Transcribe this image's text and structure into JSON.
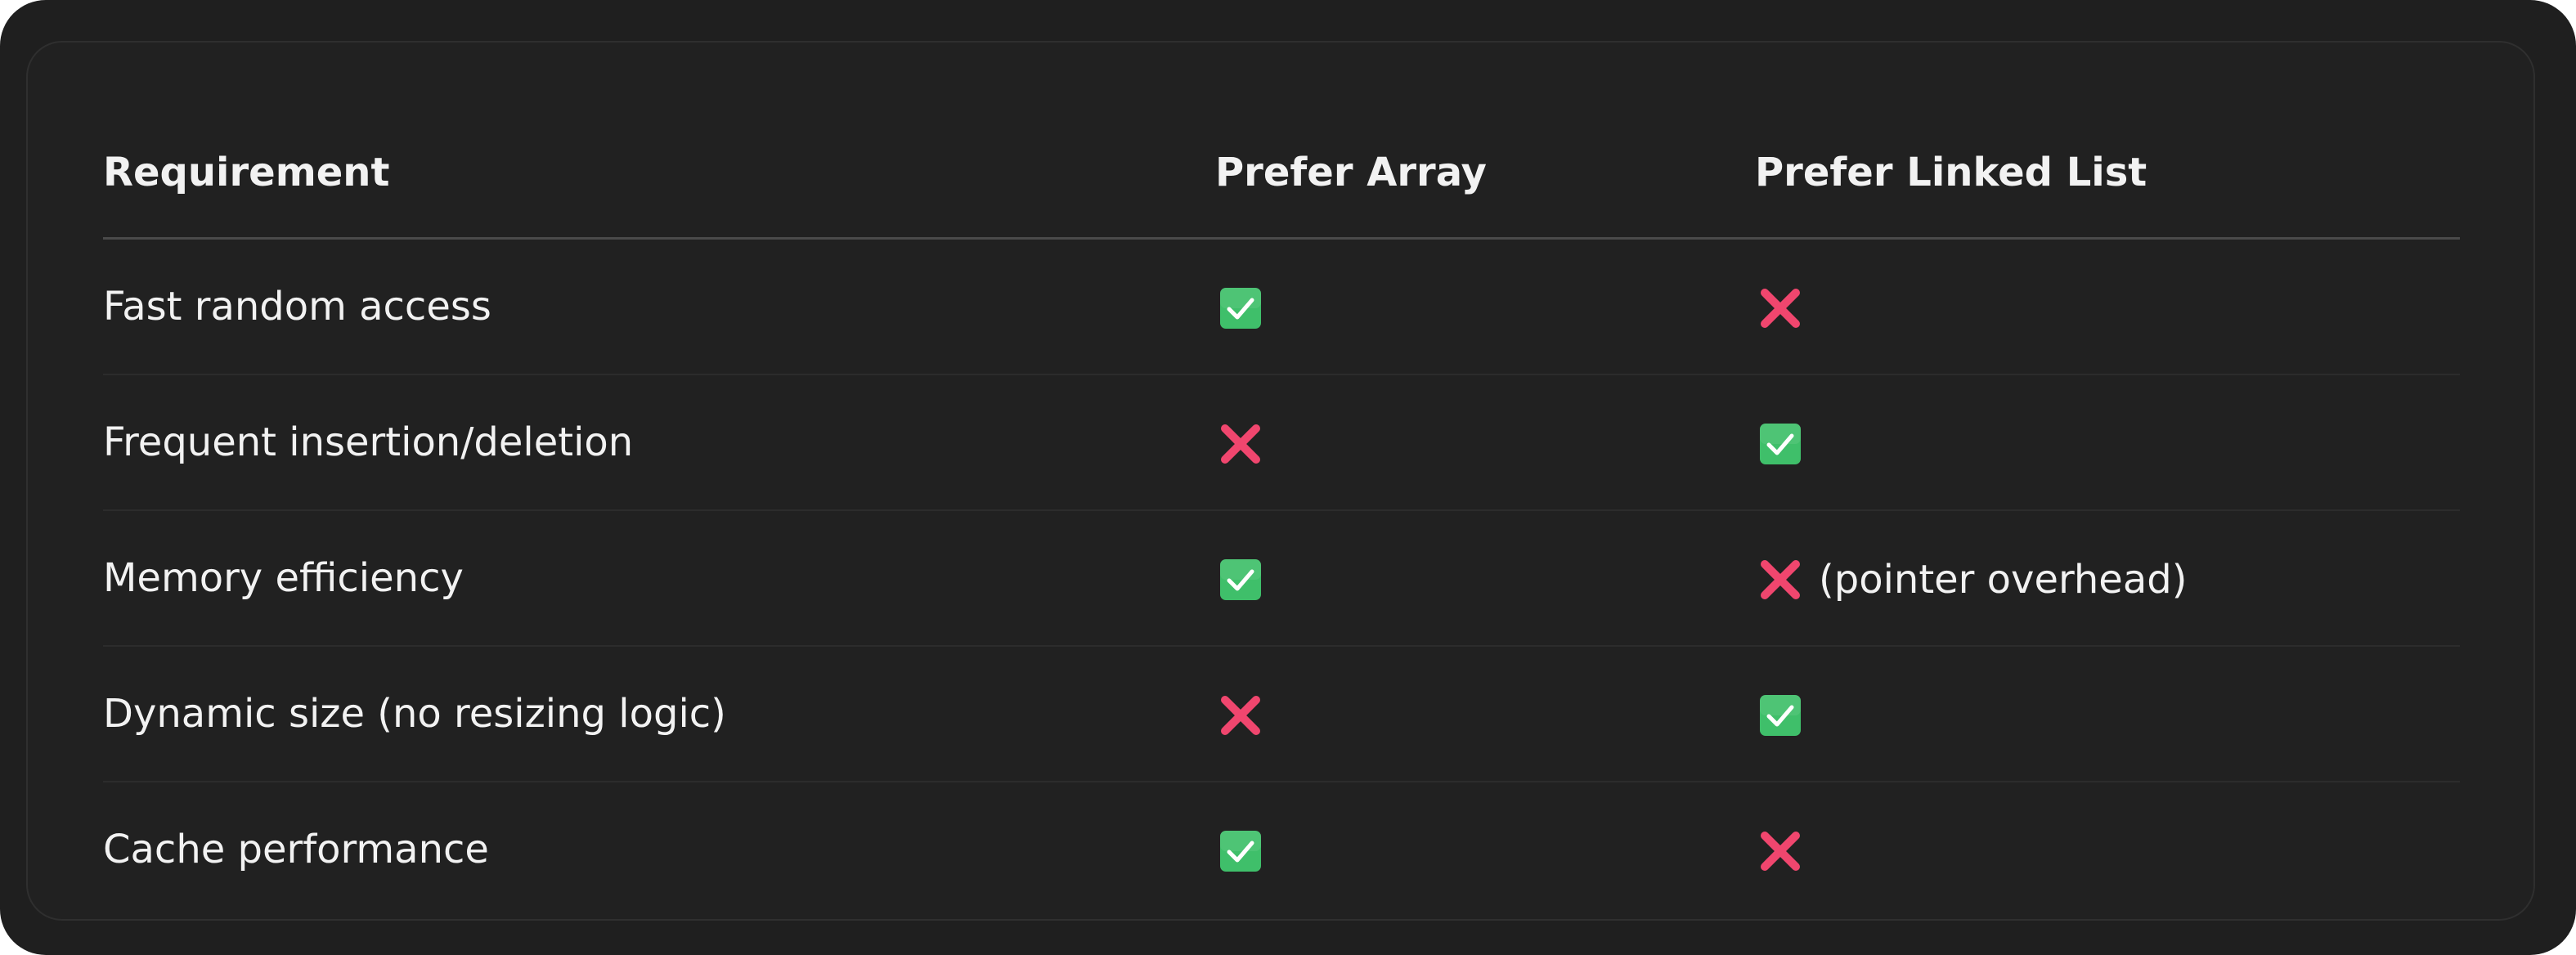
{
  "table": {
    "headers": [
      "Requirement",
      "Prefer Array",
      "Prefer Linked List"
    ],
    "rows": [
      {
        "requirement": "Fast random access",
        "array": "check",
        "list": "cross",
        "list_note": ""
      },
      {
        "requirement": "Frequent insertion/deletion",
        "array": "cross",
        "list": "check",
        "list_note": ""
      },
      {
        "requirement": "Memory efficiency",
        "array": "check",
        "list": "cross",
        "list_note": "(pointer overhead)"
      },
      {
        "requirement": "Dynamic size (no resizing logic)",
        "array": "cross",
        "list": "check",
        "list_note": ""
      },
      {
        "requirement": "Cache performance",
        "array": "check",
        "list": "cross",
        "list_note": ""
      }
    ]
  },
  "icons": {
    "check": "check-box-icon",
    "cross": "cross-mark-icon"
  },
  "colors": {
    "background": "#1f1f1f",
    "card": "#212121",
    "text": "#f2f2f2",
    "check_green": "#3fbf6a",
    "cross_red": "#f0466e"
  }
}
